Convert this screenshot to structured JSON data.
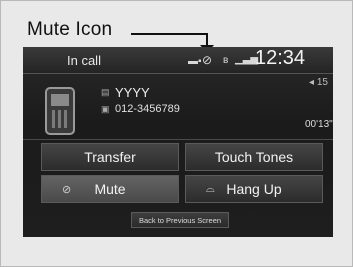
{
  "callout": {
    "label": "Mute Icon"
  },
  "status_bar": {
    "title": "In call",
    "icons": [
      "battery-icon",
      "mute-icon",
      "bluetooth-icon",
      "signal-icon"
    ],
    "time": "12:34"
  },
  "contact": {
    "name": "YYYY",
    "number": "012-3456789",
    "signal": "15",
    "duration": "00'13\""
  },
  "buttons": {
    "transfer": "Transfer",
    "touch_tones": "Touch Tones",
    "mute": "Mute",
    "hang_up": "Hang Up",
    "back": "Back to Previous Screen"
  }
}
